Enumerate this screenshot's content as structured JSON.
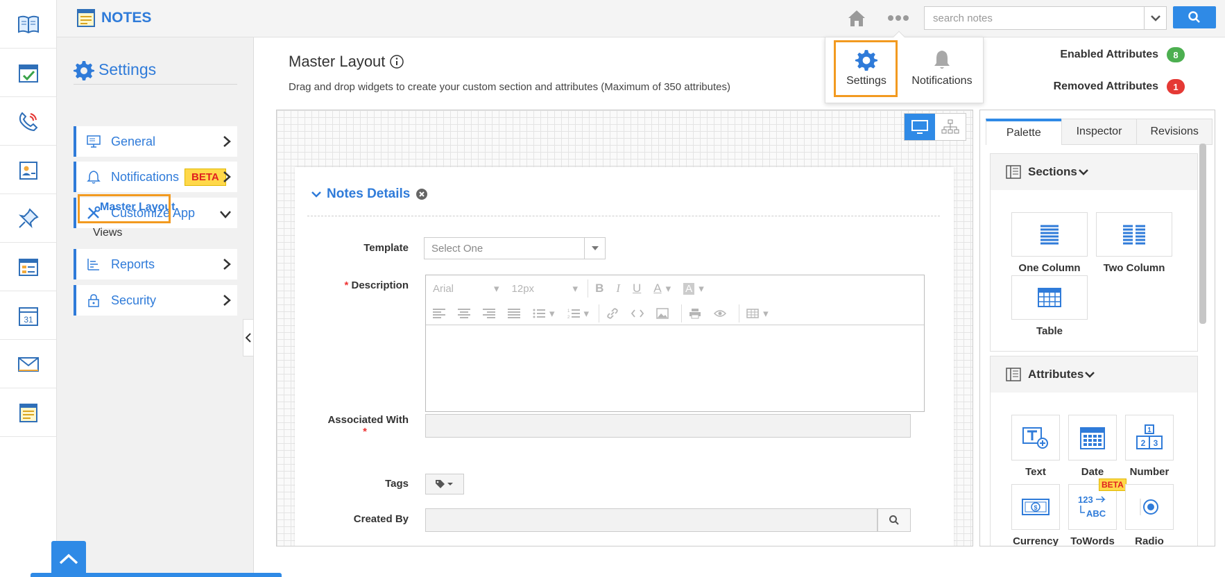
{
  "app": {
    "title": "NOTES"
  },
  "search": {
    "placeholder": "search notes"
  },
  "popup": {
    "settings_label": "Settings",
    "notifications_label": "Notifications"
  },
  "sidebar": {
    "title": "Settings",
    "items": [
      {
        "label": "General"
      },
      {
        "label": "Notifications",
        "badge": "BETA"
      },
      {
        "label": "Customize App",
        "sub": [
          "Master Layout",
          "Views"
        ]
      },
      {
        "label": "Reports"
      },
      {
        "label": "Security"
      }
    ]
  },
  "main": {
    "title": "Master Layout",
    "description": "Drag and drop widgets to create your custom section and attributes (Maximum of 350 attributes)",
    "section_title": "Notes Details",
    "fields": {
      "template_label": "Template",
      "template_value": "Select One",
      "description_label": "Description",
      "associated_label": "Associated With",
      "tags_label": "Tags",
      "created_by_label": "Created By"
    },
    "editor": {
      "font": "Arial",
      "size": "12px",
      "bold": "B",
      "italic": "I",
      "underline": "U",
      "font_color": "A",
      "bg_color": "A"
    }
  },
  "counters": {
    "enabled_label": "Enabled Attributes",
    "enabled_count": "8",
    "removed_label": "Removed Attributes",
    "removed_count": "1"
  },
  "right_panel": {
    "tabs": [
      "Palette",
      "Inspector",
      "Revisions"
    ],
    "sections_title": "Sections",
    "sections_widgets": [
      "One Column",
      "Two Column",
      "Table"
    ],
    "attributes_title": "Attributes",
    "attribute_widgets": [
      "Text",
      "Date",
      "Number",
      "Currency",
      "ToWords",
      "Radio"
    ],
    "towords_badge": "BETA",
    "number_glyphs": [
      "1",
      "2",
      "3"
    ],
    "towords_glyphs": [
      "123",
      "ABC"
    ]
  },
  "colors": {
    "accent": "#2f7bd9",
    "highlight": "#f29a20",
    "enabled_pill": "#4caf50",
    "removed_pill": "#e53935"
  }
}
